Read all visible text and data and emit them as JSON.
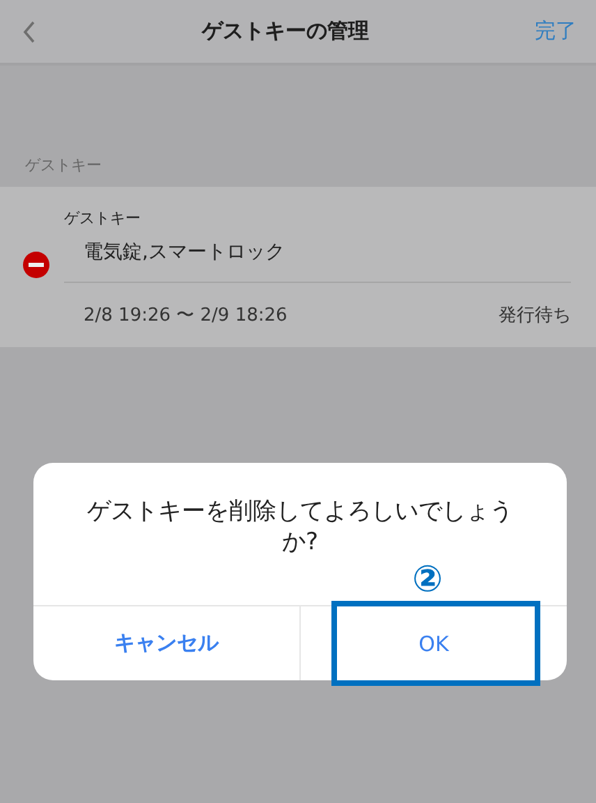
{
  "nav": {
    "title": "ゲストキーの管理",
    "done": "完了"
  },
  "section_header": "ゲストキー",
  "keys": [
    {
      "label": "ゲストキー",
      "name": "電気錠,スマートロック",
      "period": "2/8 19:26 〜 2/9 18:26",
      "status": "発行待ち"
    }
  ],
  "dialog": {
    "message": "ゲストキーを削除してよろしいでしょうか?",
    "buttons": [
      {
        "label": "キャンセル",
        "highlighted": false
      },
      {
        "label": "OK",
        "highlighted": true
      }
    ]
  },
  "annotation": {
    "label": "②"
  }
}
